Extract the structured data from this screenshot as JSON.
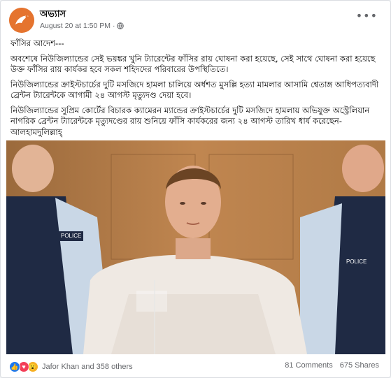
{
  "post": {
    "page_name": "অভ্যাস",
    "timestamp": "August 20 at 1:50 PM",
    "separator": "·",
    "paragraphs": [
      "ফাঁসির আদেশ---",
      "অবশেষে নিউজিল্যান্ডের সেই ভয়ঙ্কর খুনি ট্যারেন্টের ফাঁসির রায় ঘোষনা করা হয়েছে, সেই সাথে ঘোষনা করা হয়েছে উক্ত ফাঁসির রায় কার্যকর হবে সকল শহিদদের পরিবারের উপস্থিতিতে।",
      "নিউজিল্যান্ডের ক্রাইস্টচার্চের দুটি মসজিদে হামলা চালিয়ে অর্ধশত মুসল্লি হত্যা মামলার আসামি শ্বেতাঙ্গ আধিপত্যবাদী ব্রেন্টন ট্যারেন্টকে আগামী ২৪ আগস্ট মৃত্যুদণ্ড দেয়া হবে।",
      "নিউজিল্যান্ডের সুপ্রিম কোর্টের বিচারক ক্যামেরন ম্যান্ডের ক্রাইস্টচার্চের দুটি মসজিদে হামলায় অভিযুক্ত অস্ট্রেলিয়ান নাগরিক ব্রেন্টন ট্যারেন্টকে মৃত্যুদণ্ডের রায় শুনিয়ে ফাঁসি কার্যকরের জন্য ২৪ আগস্ট তারিখ ধার্য করেছেন- আলহামদুলিল্লাহ্"
    ],
    "photo_text": {
      "left_badge": "POLICE",
      "right_badge": "POLICE"
    }
  },
  "footer": {
    "reactions": [
      "like",
      "love",
      "wow"
    ],
    "reaction_names": "Jafor Khan and 358 others",
    "comments": "81 Comments",
    "shares": "675 Shares"
  },
  "icons": {
    "more": "more-horizontal-icon",
    "audience": "globe-icon"
  },
  "colors": {
    "avatar_bg": "#e5742f",
    "like": "#1877f2",
    "love": "#f33e58",
    "wow": "#f7b125"
  }
}
